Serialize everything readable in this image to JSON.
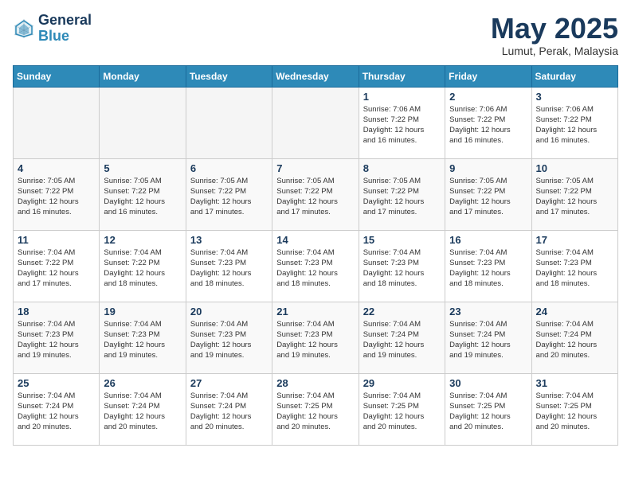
{
  "header": {
    "logo_line1": "General",
    "logo_line2": "Blue",
    "month": "May 2025",
    "location": "Lumut, Perak, Malaysia"
  },
  "weekdays": [
    "Sunday",
    "Monday",
    "Tuesday",
    "Wednesday",
    "Thursday",
    "Friday",
    "Saturday"
  ],
  "weeks": [
    [
      {
        "day": "",
        "info": ""
      },
      {
        "day": "",
        "info": ""
      },
      {
        "day": "",
        "info": ""
      },
      {
        "day": "",
        "info": ""
      },
      {
        "day": "1",
        "info": "Sunrise: 7:06 AM\nSunset: 7:22 PM\nDaylight: 12 hours\nand 16 minutes."
      },
      {
        "day": "2",
        "info": "Sunrise: 7:06 AM\nSunset: 7:22 PM\nDaylight: 12 hours\nand 16 minutes."
      },
      {
        "day": "3",
        "info": "Sunrise: 7:06 AM\nSunset: 7:22 PM\nDaylight: 12 hours\nand 16 minutes."
      }
    ],
    [
      {
        "day": "4",
        "info": "Sunrise: 7:05 AM\nSunset: 7:22 PM\nDaylight: 12 hours\nand 16 minutes."
      },
      {
        "day": "5",
        "info": "Sunrise: 7:05 AM\nSunset: 7:22 PM\nDaylight: 12 hours\nand 16 minutes."
      },
      {
        "day": "6",
        "info": "Sunrise: 7:05 AM\nSunset: 7:22 PM\nDaylight: 12 hours\nand 17 minutes."
      },
      {
        "day": "7",
        "info": "Sunrise: 7:05 AM\nSunset: 7:22 PM\nDaylight: 12 hours\nand 17 minutes."
      },
      {
        "day": "8",
        "info": "Sunrise: 7:05 AM\nSunset: 7:22 PM\nDaylight: 12 hours\nand 17 minutes."
      },
      {
        "day": "9",
        "info": "Sunrise: 7:05 AM\nSunset: 7:22 PM\nDaylight: 12 hours\nand 17 minutes."
      },
      {
        "day": "10",
        "info": "Sunrise: 7:05 AM\nSunset: 7:22 PM\nDaylight: 12 hours\nand 17 minutes."
      }
    ],
    [
      {
        "day": "11",
        "info": "Sunrise: 7:04 AM\nSunset: 7:22 PM\nDaylight: 12 hours\nand 17 minutes."
      },
      {
        "day": "12",
        "info": "Sunrise: 7:04 AM\nSunset: 7:22 PM\nDaylight: 12 hours\nand 18 minutes."
      },
      {
        "day": "13",
        "info": "Sunrise: 7:04 AM\nSunset: 7:23 PM\nDaylight: 12 hours\nand 18 minutes."
      },
      {
        "day": "14",
        "info": "Sunrise: 7:04 AM\nSunset: 7:23 PM\nDaylight: 12 hours\nand 18 minutes."
      },
      {
        "day": "15",
        "info": "Sunrise: 7:04 AM\nSunset: 7:23 PM\nDaylight: 12 hours\nand 18 minutes."
      },
      {
        "day": "16",
        "info": "Sunrise: 7:04 AM\nSunset: 7:23 PM\nDaylight: 12 hours\nand 18 minutes."
      },
      {
        "day": "17",
        "info": "Sunrise: 7:04 AM\nSunset: 7:23 PM\nDaylight: 12 hours\nand 18 minutes."
      }
    ],
    [
      {
        "day": "18",
        "info": "Sunrise: 7:04 AM\nSunset: 7:23 PM\nDaylight: 12 hours\nand 19 minutes."
      },
      {
        "day": "19",
        "info": "Sunrise: 7:04 AM\nSunset: 7:23 PM\nDaylight: 12 hours\nand 19 minutes."
      },
      {
        "day": "20",
        "info": "Sunrise: 7:04 AM\nSunset: 7:23 PM\nDaylight: 12 hours\nand 19 minutes."
      },
      {
        "day": "21",
        "info": "Sunrise: 7:04 AM\nSunset: 7:23 PM\nDaylight: 12 hours\nand 19 minutes."
      },
      {
        "day": "22",
        "info": "Sunrise: 7:04 AM\nSunset: 7:24 PM\nDaylight: 12 hours\nand 19 minutes."
      },
      {
        "day": "23",
        "info": "Sunrise: 7:04 AM\nSunset: 7:24 PM\nDaylight: 12 hours\nand 19 minutes."
      },
      {
        "day": "24",
        "info": "Sunrise: 7:04 AM\nSunset: 7:24 PM\nDaylight: 12 hours\nand 20 minutes."
      }
    ],
    [
      {
        "day": "25",
        "info": "Sunrise: 7:04 AM\nSunset: 7:24 PM\nDaylight: 12 hours\nand 20 minutes."
      },
      {
        "day": "26",
        "info": "Sunrise: 7:04 AM\nSunset: 7:24 PM\nDaylight: 12 hours\nand 20 minutes."
      },
      {
        "day": "27",
        "info": "Sunrise: 7:04 AM\nSunset: 7:24 PM\nDaylight: 12 hours\nand 20 minutes."
      },
      {
        "day": "28",
        "info": "Sunrise: 7:04 AM\nSunset: 7:25 PM\nDaylight: 12 hours\nand 20 minutes."
      },
      {
        "day": "29",
        "info": "Sunrise: 7:04 AM\nSunset: 7:25 PM\nDaylight: 12 hours\nand 20 minutes."
      },
      {
        "day": "30",
        "info": "Sunrise: 7:04 AM\nSunset: 7:25 PM\nDaylight: 12 hours\nand 20 minutes."
      },
      {
        "day": "31",
        "info": "Sunrise: 7:04 AM\nSunset: 7:25 PM\nDaylight: 12 hours\nand 20 minutes."
      }
    ]
  ]
}
